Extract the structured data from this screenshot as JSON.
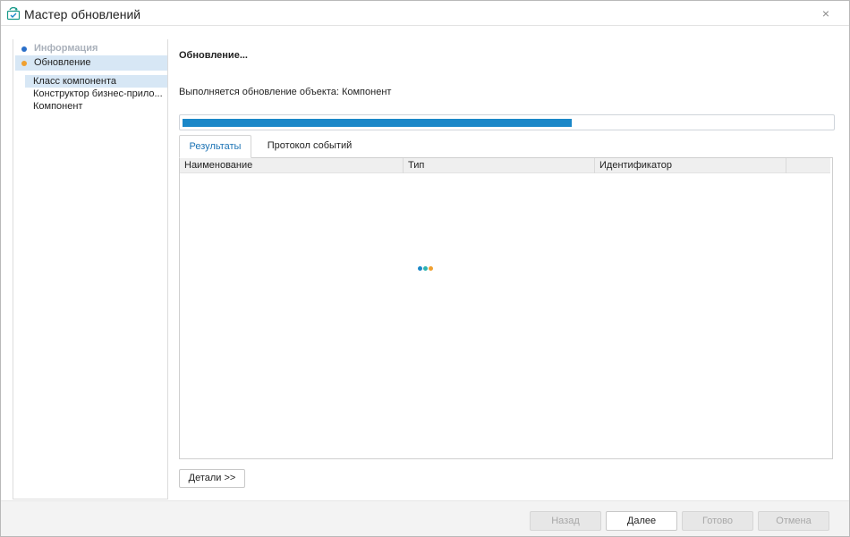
{
  "window": {
    "title": "Мастер обновлений",
    "close_glyph": "×",
    "icon": "update-wizard-icon"
  },
  "sidebar": {
    "steps": [
      {
        "label": "Информация",
        "state": "done",
        "dot_color": "#2a6fc9"
      },
      {
        "label": "Обновление",
        "state": "current",
        "dot_color": "#f0a030"
      }
    ],
    "substeps": [
      {
        "label": "Класс компонента",
        "selected": true
      },
      {
        "label": "Конструктор бизнес-прило...",
        "selected": false
      },
      {
        "label": "Компонент",
        "selected": false
      }
    ]
  },
  "main": {
    "title": "Обновление...",
    "status": "Выполняется обновление объекта: Компонент",
    "progress": 0.6
  },
  "tabs": [
    {
      "label": "Результаты",
      "active": true
    },
    {
      "label": "Протокол событий",
      "active": false
    }
  ],
  "grid": {
    "columns": [
      "Наименование",
      "Тип",
      "Идентификатор",
      ""
    ],
    "rows": [],
    "loading": true
  },
  "details_button": "Детали >>",
  "footer": {
    "back": "Назад",
    "next": "Далее",
    "done": "Готово",
    "cancel": "Отмена"
  },
  "colors": {
    "accent": "#1a87c8",
    "selection": "#d7e7f5",
    "active_tab_text": "#1d74b5"
  }
}
